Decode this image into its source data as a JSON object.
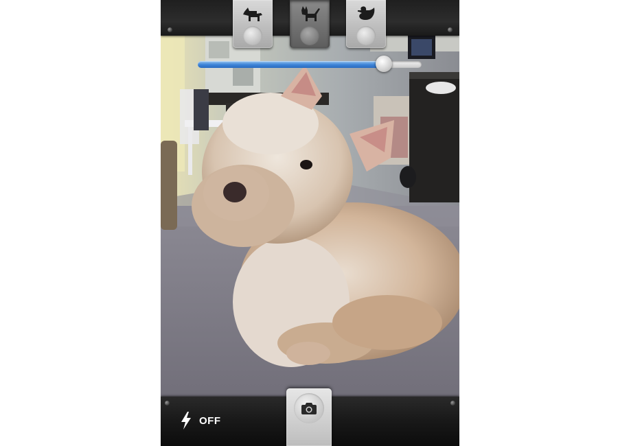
{
  "mode_selector": {
    "modes": [
      {
        "id": "dog",
        "icon": "dog-icon",
        "active": false
      },
      {
        "id": "cat",
        "icon": "cat-icon",
        "active": true
      },
      {
        "id": "duck",
        "icon": "duck-icon",
        "active": false
      }
    ]
  },
  "sound_slider": {
    "level": 0.83,
    "fill_color": "#3c82d6"
  },
  "bottom_bar": {
    "flash": {
      "icon": "lightning-bolt-icon",
      "label": "OFF"
    },
    "shutter": {
      "icon": "camera-icon"
    }
  },
  "viewfinder": {
    "subject": "photo-subject-terrier"
  }
}
